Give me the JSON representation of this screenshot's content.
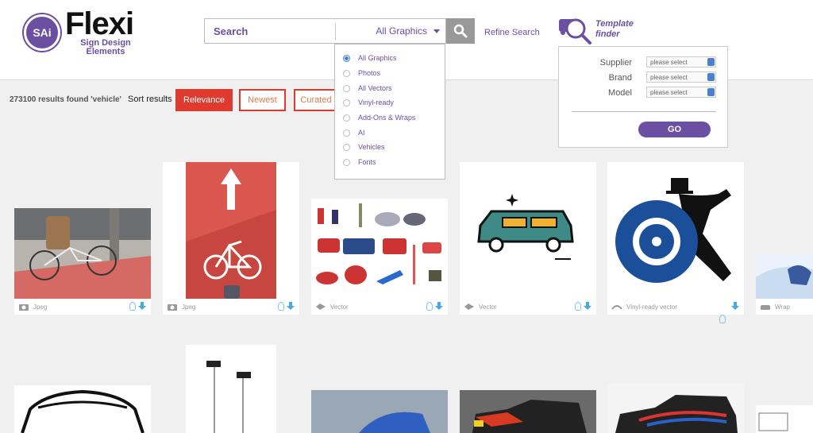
{
  "logo": {
    "badge": "SAi",
    "title": "Flexi",
    "subtitle": "Sign Design Elements"
  },
  "search": {
    "label": "Search",
    "category": "All Graphics",
    "button_icon": "magnifier-icon"
  },
  "refine_label": "Refine Search",
  "template_finder": {
    "label_line1": "Template",
    "label_line2": "finder",
    "fields": [
      {
        "label": "Supplier",
        "value": "please select"
      },
      {
        "label": "Brand",
        "value": "please select"
      },
      {
        "label": "Model",
        "value": "please select"
      }
    ],
    "go_label": "GO"
  },
  "results": {
    "count_text": "273100 results found 'vehicle'",
    "sort_label": "Sort results"
  },
  "sort_buttons": {
    "relevance": "Relevance",
    "newest": "Newest",
    "curated": "Curated"
  },
  "category_dropdown": {
    "options": [
      "All Graphics",
      "Photos",
      "All Vectors",
      "Vinyl-ready",
      "Add-Ons & Wraps",
      "AI",
      "Vehicles",
      "Fonts"
    ],
    "selected": "All Graphics"
  },
  "cards": [
    {
      "type": "Jpeg",
      "icon": "camera-icon"
    },
    {
      "type": "Jpeg",
      "icon": "camera-icon"
    },
    {
      "type": "Vector",
      "icon": "vector-icon"
    },
    {
      "type": "Vector",
      "icon": "vector-icon"
    },
    {
      "type": "Vinyl-ready vector",
      "icon": "vinyl-icon"
    },
    {
      "type": "Wrap",
      "icon": "wrap-icon"
    }
  ],
  "colors": {
    "brand": "#6a4fa3",
    "accent_red": "#e03a2e",
    "link_blue": "#4aa8e0"
  }
}
